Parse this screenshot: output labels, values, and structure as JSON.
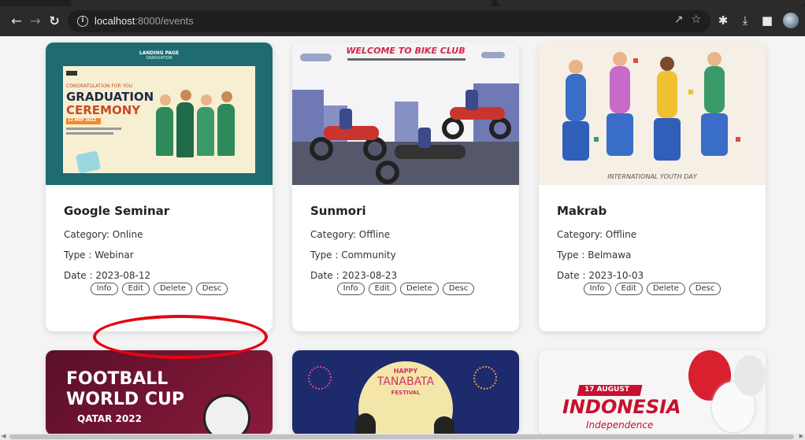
{
  "browser": {
    "url_host": "localhost",
    "url_rest": ":8000/events"
  },
  "events": [
    {
      "title": "Google Seminar",
      "category": "Category: Online",
      "type": "Type : Webinar",
      "date": "Date : 2023-08-12",
      "image_texts": {
        "top": "LANDING PAGE",
        "top2": "GRADUATION",
        "small": "CONGRATULATION FOR YOU",
        "big1": "GRADUATION",
        "big2": "CEREMONY",
        "badge": "12 MAY 2022"
      }
    },
    {
      "title": "Sunmori",
      "category": "Category: Offline",
      "type": "Type : Community",
      "date": "Date : 2023-08-23",
      "image_texts": {
        "top": "WELCOME TO BIKE CLUB"
      }
    },
    {
      "title": "Makrab",
      "category": "Category: Offline",
      "type": "Type : Belmawa",
      "date": "Date : 2023-10-03",
      "image_texts": {
        "bottom": "INTERNATIONAL YOUTH DAY"
      }
    }
  ],
  "bottom_cards": [
    {
      "line1": "FOOTBALL",
      "line2": "WORLD CUP",
      "line3": "QATAR 2022"
    },
    {
      "line1": "HAPPY",
      "line2": "TANABATA",
      "line3": "FESTIVAL"
    },
    {
      "line1": "17 AUGUST",
      "line2": "INDONESIA",
      "line3": "Independence"
    }
  ],
  "buttons": {
    "info": "Info",
    "edit": "Edit",
    "delete": "Delete",
    "desc": "Desc"
  },
  "colors": {
    "annotation": "#e30613",
    "teal": "#1f6b72",
    "navy": "#1d2a6b"
  }
}
